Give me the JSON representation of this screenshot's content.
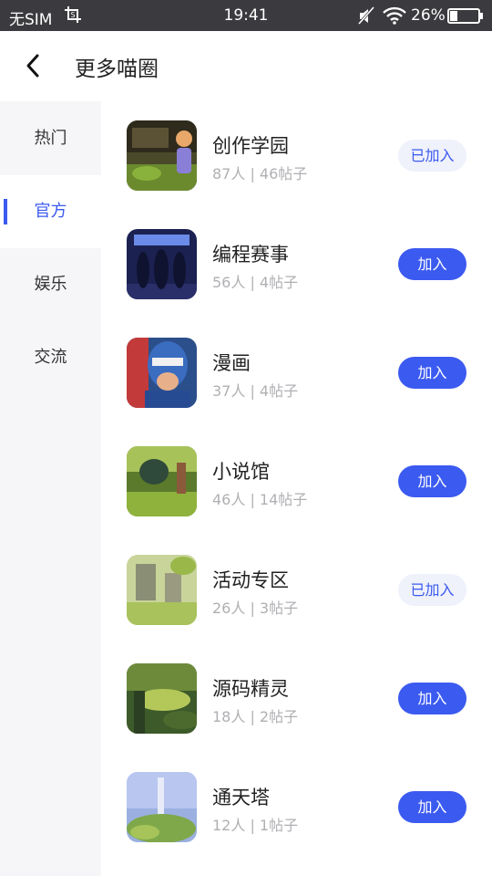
{
  "status_bar": {
    "carrier": "无SIM",
    "time": "19:41",
    "battery": "26%"
  },
  "header": {
    "title": "更多喵圈"
  },
  "sidebar": {
    "items": [
      {
        "label": "热门"
      },
      {
        "label": "官方"
      },
      {
        "label": "娱乐"
      },
      {
        "label": "交流"
      }
    ],
    "active": "官方"
  },
  "circles": [
    {
      "name": "创作学园",
      "members": "87人",
      "posts": "46帖子",
      "stats": "87人 | 46帖子",
      "button": "已加入",
      "joined": true
    },
    {
      "name": "编程赛事",
      "members": "56人",
      "posts": "4帖子",
      "stats": "56人 | 4帖子",
      "button": "加入",
      "joined": false
    },
    {
      "name": "漫画",
      "members": "37人",
      "posts": "4帖子",
      "stats": "37人 | 4帖子",
      "button": "加入",
      "joined": false
    },
    {
      "name": "小说馆",
      "members": "46人",
      "posts": "14帖子",
      "stats": "46人 | 14帖子",
      "button": "加入",
      "joined": false
    },
    {
      "name": "活动专区",
      "members": "26人",
      "posts": "3帖子",
      "stats": "26人 | 3帖子",
      "button": "已加入",
      "joined": true
    },
    {
      "name": "源码精灵",
      "members": "18人",
      "posts": "2帖子",
      "stats": "18人 | 2帖子",
      "button": "加入",
      "joined": false
    },
    {
      "name": "通天塔",
      "members": "12人",
      "posts": "1帖子",
      "stats": "12人 | 1帖子",
      "button": "加入",
      "joined": false
    }
  ],
  "colors": {
    "accent": "#3b5af0",
    "joined_bg": "#eff1fb",
    "status_bar_bg": "#3b3b3f",
    "sidebar_bg": "#f6f6f9"
  },
  "icons": {
    "back": "chevron-left-icon",
    "screenshot": "screenshot-icon",
    "mute": "mute-icon",
    "wifi": "wifi-icon",
    "battery": "battery-icon"
  }
}
